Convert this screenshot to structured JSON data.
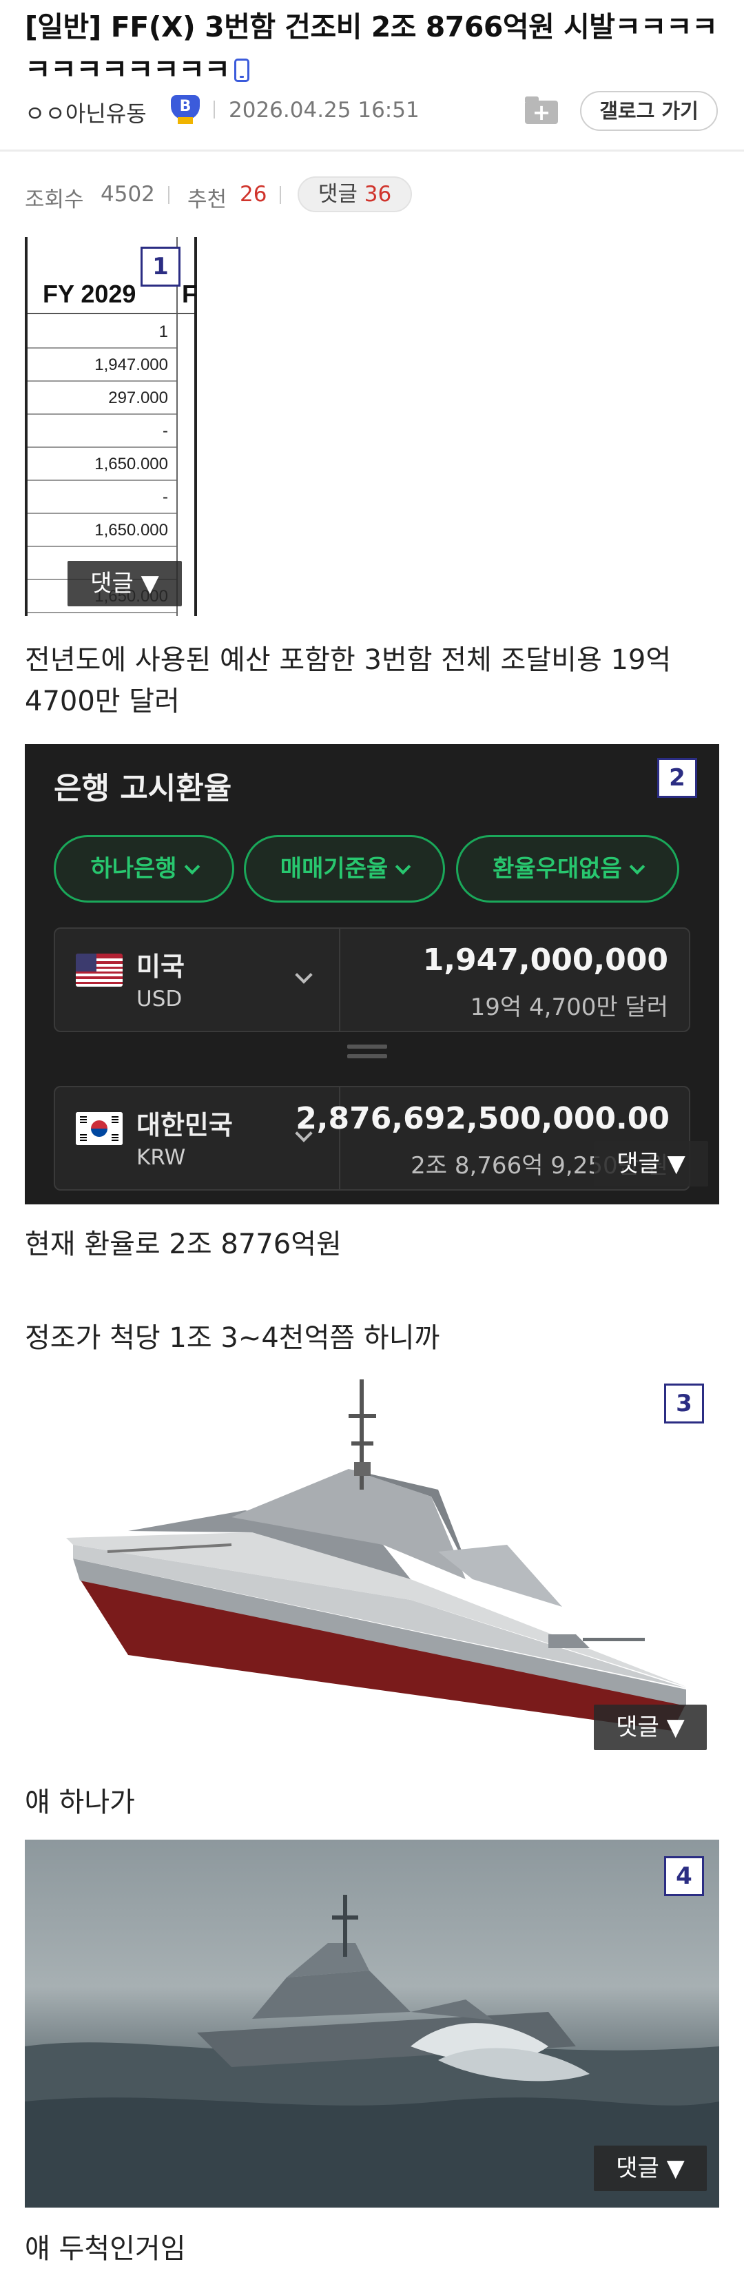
{
  "post": {
    "title": "[일반] FF(X) 3번함 건조비 2조 8766억원 시발ㅋㅋㅋㅋㅋㅋㅋㅋㅋㅋㅋㅋ",
    "author": "ㅇㅇ아닌유동",
    "author_badge": "B",
    "date": "2026.04.25 16:51",
    "gallery_button": "갤로그 가기",
    "stats": {
      "views_label": "조회수",
      "views": "4502",
      "recommend_label": "추천",
      "recommend": "26",
      "comments_label": "댓글",
      "comments": "36"
    }
  },
  "common": {
    "comment_button": "댓글 ▼"
  },
  "image1": {
    "number": "1",
    "header": "FY 2029",
    "header_next": "F",
    "rows": [
      "1",
      "1,947.000",
      "297.000",
      "-",
      "1,650.000",
      "-",
      "1,650.000",
      "",
      "1,650.000"
    ]
  },
  "text1": "전년도에 사용된 예산 포함한 3번함 전체 조달비용 19억 4700만 달러",
  "image2": {
    "number": "2",
    "title": "은행 고시환율",
    "chips": [
      "하나은행",
      "매매기준율",
      "환율우대없음"
    ],
    "from": {
      "name": "미국",
      "code": "USD",
      "value": "1,947,000,000",
      "sub": "19억 4,700만 달러"
    },
    "to": {
      "name": "대한민국",
      "code": "KRW",
      "value": "2,876,692,500,000.00",
      "sub": "2조 8,766억 9,250만 원"
    }
  },
  "text2": "현재 환율로 2조 8776억원",
  "text3": "정조가 척당 1조 3~4천억쯤 하니까",
  "image3": {
    "number": "3"
  },
  "text4": "얘 하나가",
  "image4": {
    "number": "4"
  },
  "text5": "얘 두척인거임",
  "colors": {
    "accent_green": "#28c76f",
    "badge_navy": "#2b2d83",
    "count_red": "#d0342c"
  },
  "icons": [
    "phone-icon",
    "gallery-add-icon",
    "chevron-down-icon",
    "usa-flag-icon",
    "korea-flag-icon"
  ]
}
